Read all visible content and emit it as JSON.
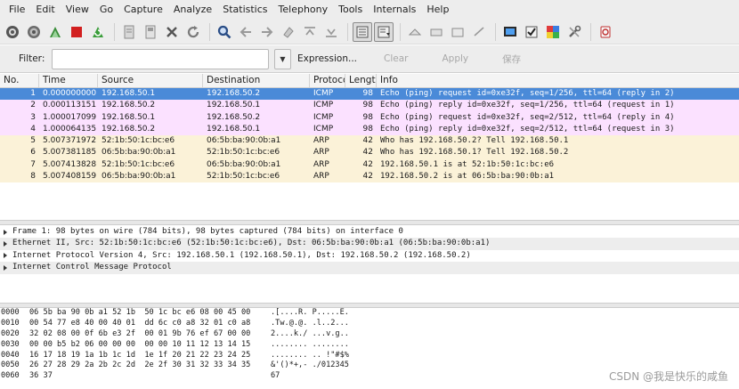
{
  "menu": [
    "File",
    "Edit",
    "View",
    "Go",
    "Capture",
    "Analyze",
    "Statistics",
    "Telephony",
    "Tools",
    "Internals",
    "Help"
  ],
  "toolbar": {
    "icons": [
      "interface-list-icon",
      "capture-options-icon",
      "start-capture-icon",
      "stop-capture-icon",
      "restart-capture-icon",
      "open-file-icon",
      "save-file-icon",
      "close-file-icon",
      "reload-icon",
      "find-packet-icon",
      "go-back-icon",
      "go-forward-icon",
      "go-to-packet-icon",
      "go-first-icon",
      "go-last-icon",
      "colorize-icon",
      "auto-scroll-icon",
      "zoom-in-icon",
      "zoom-out-icon",
      "normal-size-icon",
      "resize-columns-icon",
      "capture-filters-icon",
      "display-filters-icon",
      "coloring-rules-icon",
      "preferences-icon",
      "help-icon"
    ]
  },
  "filter": {
    "label": "Filter:",
    "value": "",
    "placeholder": "",
    "expression": "Expression...",
    "clear": "Clear",
    "apply": "Apply",
    "save": "保存"
  },
  "columns": [
    "No.",
    "Time",
    "Source",
    "Destination",
    "Protocol",
    "Length",
    "Info"
  ],
  "packets": [
    {
      "no": "1",
      "time": "0.000000000",
      "src": "192.168.50.1",
      "dst": "192.168.50.2",
      "proto": "ICMP",
      "len": "98",
      "info": "Echo (ping) request  id=0xe32f, seq=1/256, ttl=64 (reply in 2)",
      "kind": "sel"
    },
    {
      "no": "2",
      "time": "0.000113151",
      "src": "192.168.50.2",
      "dst": "192.168.50.1",
      "proto": "ICMP",
      "len": "98",
      "info": "Echo (ping) reply    id=0xe32f, seq=1/256, ttl=64 (request in 1)",
      "kind": "icmp"
    },
    {
      "no": "3",
      "time": "1.000017099",
      "src": "192.168.50.1",
      "dst": "192.168.50.2",
      "proto": "ICMP",
      "len": "98",
      "info": "Echo (ping) request  id=0xe32f, seq=2/512, ttl=64 (reply in 4)",
      "kind": "icmp"
    },
    {
      "no": "4",
      "time": "1.000064135",
      "src": "192.168.50.2",
      "dst": "192.168.50.1",
      "proto": "ICMP",
      "len": "98",
      "info": "Echo (ping) reply    id=0xe32f, seq=2/512, ttl=64 (request in 3)",
      "kind": "icmp"
    },
    {
      "no": "5",
      "time": "5.007371972",
      "src": "52:1b:50:1c:bc:e6",
      "dst": "06:5b:ba:90:0b:a1",
      "proto": "ARP",
      "len": "42",
      "info": "Who has 192.168.50.2?  Tell 192.168.50.1",
      "kind": "arp"
    },
    {
      "no": "6",
      "time": "5.007381185",
      "src": "06:5b:ba:90:0b:a1",
      "dst": "52:1b:50:1c:bc:e6",
      "proto": "ARP",
      "len": "42",
      "info": "Who has 192.168.50.1?  Tell 192.168.50.2",
      "kind": "arp"
    },
    {
      "no": "7",
      "time": "5.007413828",
      "src": "52:1b:50:1c:bc:e6",
      "dst": "06:5b:ba:90:0b:a1",
      "proto": "ARP",
      "len": "42",
      "info": "192.168.50.1 is at 52:1b:50:1c:bc:e6",
      "kind": "arp"
    },
    {
      "no": "8",
      "time": "5.007408159",
      "src": "06:5b:ba:90:0b:a1",
      "dst": "52:1b:50:1c:bc:e6",
      "proto": "ARP",
      "len": "42",
      "info": "192.168.50.2 is at 06:5b:ba:90:0b:a1",
      "kind": "arp"
    }
  ],
  "details": [
    "Frame 1: 98 bytes on wire (784 bits), 98 bytes captured (784 bits) on interface 0",
    "Ethernet II, Src: 52:1b:50:1c:bc:e6 (52:1b:50:1c:bc:e6), Dst: 06:5b:ba:90:0b:a1 (06:5b:ba:90:0b:a1)",
    "Internet Protocol Version 4, Src: 192.168.50.1 (192.168.50.1), Dst: 192.168.50.2 (192.168.50.2)",
    "Internet Control Message Protocol"
  ],
  "bytes": [
    {
      "off": "0000",
      "hex": "06 5b ba 90 0b a1 52 1b  50 1c bc e6 08 00 45 00",
      "ascii": ".[....R. P.....E."
    },
    {
      "off": "0010",
      "hex": "00 54 77 e8 40 00 40 01  dd 6c c0 a8 32 01 c0 a8",
      "ascii": ".Tw.@.@. .l..2..."
    },
    {
      "off": "0020",
      "hex": "32 02 08 00 0f 6b e3 2f  00 01 9b 76 ef 67 00 00",
      "ascii": "2....k./ ...v.g.."
    },
    {
      "off": "0030",
      "hex": "00 00 b5 b2 06 00 00 00  00 00 10 11 12 13 14 15",
      "ascii": "........ ........"
    },
    {
      "off": "0040",
      "hex": "16 17 18 19 1a 1b 1c 1d  1e 1f 20 21 22 23 24 25",
      "ascii": "........ .. !\"#$%"
    },
    {
      "off": "0050",
      "hex": "26 27 28 29 2a 2b 2c 2d  2e 2f 30 31 32 33 34 35",
      "ascii": "&'()*+,- ./012345"
    },
    {
      "off": "0060",
      "hex": "36 37                                          ",
      "ascii": "67"
    }
  ],
  "watermark": "CSDN @我是快乐的咸鱼"
}
